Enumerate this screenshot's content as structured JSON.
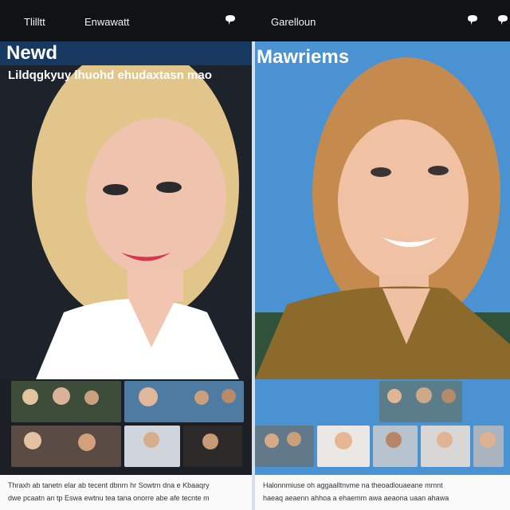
{
  "left": {
    "topbar": {
      "left_label": "Tlilltt",
      "center_label": "Enwawatt"
    },
    "headline": "Newd",
    "subline": "Lildqgkyuy lhuohd ehudaxtasn mao",
    "textblock": {
      "line1": "Thraxh ab tanetn elar ab tecent dbnrn hr Sowtrn dna e Kbaaqry",
      "line2": "dwe pcaatn an tp Eswa ewtnu tea tana onorre abe afe tecnte m"
    }
  },
  "right": {
    "topbar": {
      "center_label": "Garelloun"
    },
    "headline": "Mawriems",
    "textblock": {
      "line1": "Halonnmiuse oh aggaalltnvme na theoadlouaeane mmnt",
      "line2": "haeaq aeaenn ahhoa a ehaemm awa aeaona uaan ahawa"
    }
  },
  "colors": {
    "topbar": "#111216",
    "headline_bar": "#17385f",
    "left_bg": "#1c1f26",
    "right_sky": "#4b92d2",
    "left_hair": "#e1c58a",
    "right_hair": "#c58b4e"
  }
}
